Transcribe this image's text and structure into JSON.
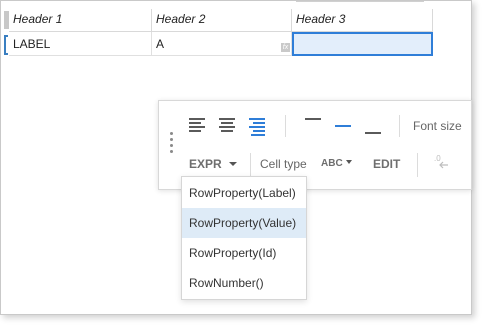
{
  "grid": {
    "headers": [
      "Header 1",
      "Header 2",
      "Header 3"
    ],
    "row": [
      "LABEL",
      "A",
      ""
    ],
    "formula_icon": "fx"
  },
  "toolbar": {
    "align_icons": [
      "align-left-icon",
      "align-center-icon",
      "align-right-icon"
    ],
    "valign_icons": [
      "valign-top-icon",
      "valign-middle-icon",
      "valign-bottom-icon"
    ],
    "font_size_label": "Font size",
    "expr_label": "EXPR",
    "cell_type_label": "Cell type",
    "abc_label": "ABC",
    "edit_label": "EDIT",
    "decimal_icon": "decrease-decimal-icon"
  },
  "menu": {
    "items": [
      "RowProperty(Label)",
      "RowProperty(Value)",
      "RowProperty(Id)",
      "RowNumber()"
    ],
    "selected": "RowProperty(Value)"
  },
  "colors": {
    "accent": "#2f7ed8",
    "selection_bg": "#e3eefb",
    "menu_selected_bg": "#deebf7"
  }
}
